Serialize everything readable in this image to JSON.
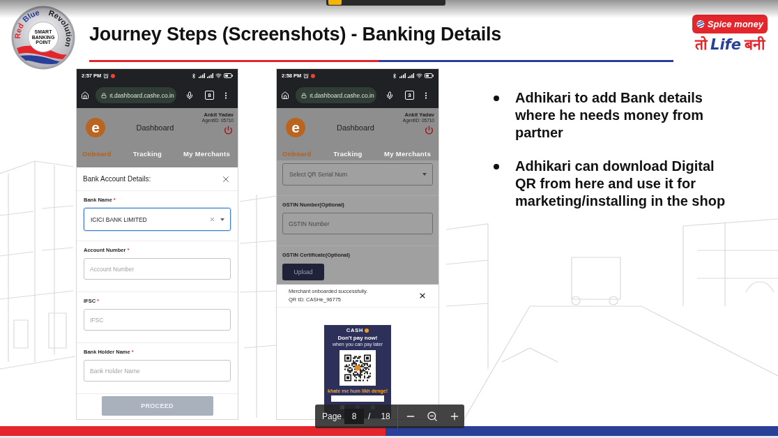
{
  "slide": {
    "logo": {
      "arc_words": [
        {
          "text": "Red",
          "color": "#e4262c"
        },
        {
          "text": "Blue",
          "color": "#2a3f98"
        },
        {
          "text": "Revolution",
          "color": "#1f1f1f"
        }
      ],
      "center_lines": [
        "SMART",
        "BANKING",
        "POINT"
      ]
    },
    "title": "Journey Steps (Screenshots) - Banking Details",
    "brand": {
      "name": "Spice money",
      "tagline": [
        {
          "text": "तो",
          "color": "#e4262c",
          "italic": false
        },
        {
          "text": "Life",
          "color": "#2a3f98",
          "italic": true
        },
        {
          "text": "बनी",
          "color": "#e4262c",
          "italic": false
        }
      ]
    },
    "screenshots": [
      {
        "kind": "bank_form",
        "status_time": "2:57 PM",
        "url": "ıt.dashboard.cashe.co.in",
        "tab_count": "8",
        "app": {
          "logo_letter": "e",
          "title": "Dashboard",
          "user_name": "Ankit Yadav",
          "agent_id": "AgentID: 05710"
        },
        "tabs": [
          {
            "label": "Onboard",
            "selected": true
          },
          {
            "label": "Tracking",
            "selected": false
          },
          {
            "label": "My Merchants",
            "selected": false
          }
        ],
        "modal": {
          "title": "Bank Account Details:",
          "fields": [
            {
              "kind": "select",
              "label": "Bank Name",
              "required_mark": "*",
              "value": "ICICI BANK LIMITED",
              "focused": true
            },
            {
              "kind": "input",
              "label": "Account Number",
              "required_mark": "*",
              "placeholder": "Account Number",
              "focused": false
            },
            {
              "kind": "input",
              "label": "IFSC",
              "required_mark": "*",
              "placeholder": "IFSC",
              "focused": false
            },
            {
              "kind": "input",
              "label": "Bank Holder Name",
              "required_mark": "*",
              "placeholder": "Bank Holder Name",
              "focused": false
            }
          ],
          "button": {
            "label": "PROCEED",
            "disabled": true
          }
        }
      },
      {
        "kind": "qr_result",
        "status_time": "2:58 PM",
        "url": "ıt.dashboard.cashe.co.in",
        "tab_count": "3",
        "app": {
          "logo_letter": "e",
          "title": "Dashboard",
          "user_name": "Ankit Yadav",
          "agent_id": "AgentID: 05710"
        },
        "tabs": [
          {
            "label": "Onboard",
            "selected": true
          },
          {
            "label": "Tracking",
            "selected": false
          },
          {
            "label": "My Merchants",
            "selected": false
          }
        ],
        "form": {
          "fields": [
            {
              "kind": "select",
              "placeholder": "Select QR Serial Num",
              "focused": false
            },
            {
              "kind": "input",
              "label": "GSTIN Number(Optional)",
              "placeholder": "GSTIN Number",
              "focused": false
            },
            {
              "kind": "upload",
              "label": "GSTIN Certificate(Optional)",
              "button": "Upload"
            }
          ]
        },
        "toast": {
          "lines": [
            "Merchant onboarded successfully.",
            "QR ID: CASHe_96775"
          ]
        },
        "qr_poster": {
          "brand": "CASH",
          "headline": "Don't pay now!",
          "subline": "when you can pay later",
          "tagline": "khate me hum likh denge!"
        }
      }
    ],
    "bullets": [
      "Adhikari to add Bank details where he needs money from partner",
      "Adhikari can download Digital QR from here and use it for marketing/installing in the shop"
    ]
  },
  "page_toolbar": {
    "label": "Page",
    "page": "8",
    "separator": "/",
    "total": "18"
  }
}
